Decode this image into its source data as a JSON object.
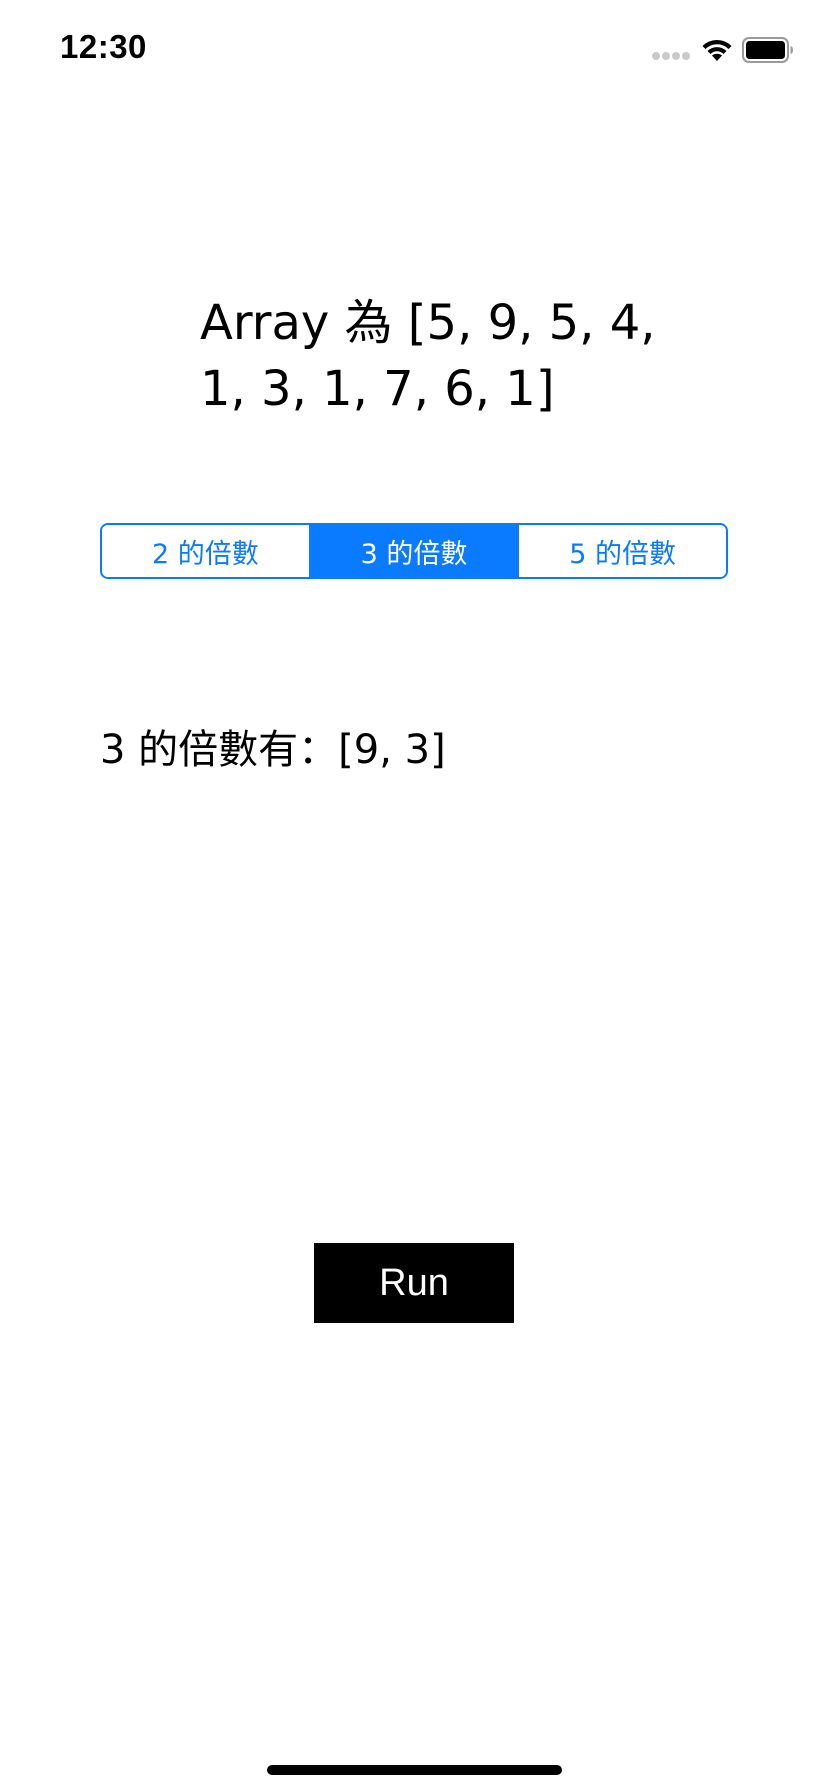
{
  "status_bar": {
    "time": "12:30"
  },
  "content": {
    "array_label": "Array 為 [5, 9, 5, 4, 1, 3, 1, 7, 6, 1]",
    "segments": [
      {
        "label": "2 的倍數",
        "selected": false
      },
      {
        "label": "3 的倍數",
        "selected": true
      },
      {
        "label": "5 的倍數",
        "selected": false
      }
    ],
    "result_label": "3 的倍數有：[9, 3]",
    "run_button_label": "Run"
  },
  "colors": {
    "accent": "#0a7aff",
    "button_background": "#000000",
    "button_text": "#ffffff"
  },
  "icons": {
    "signal": "signal-dots-icon",
    "wifi": "wifi-icon",
    "battery": "battery-icon"
  }
}
